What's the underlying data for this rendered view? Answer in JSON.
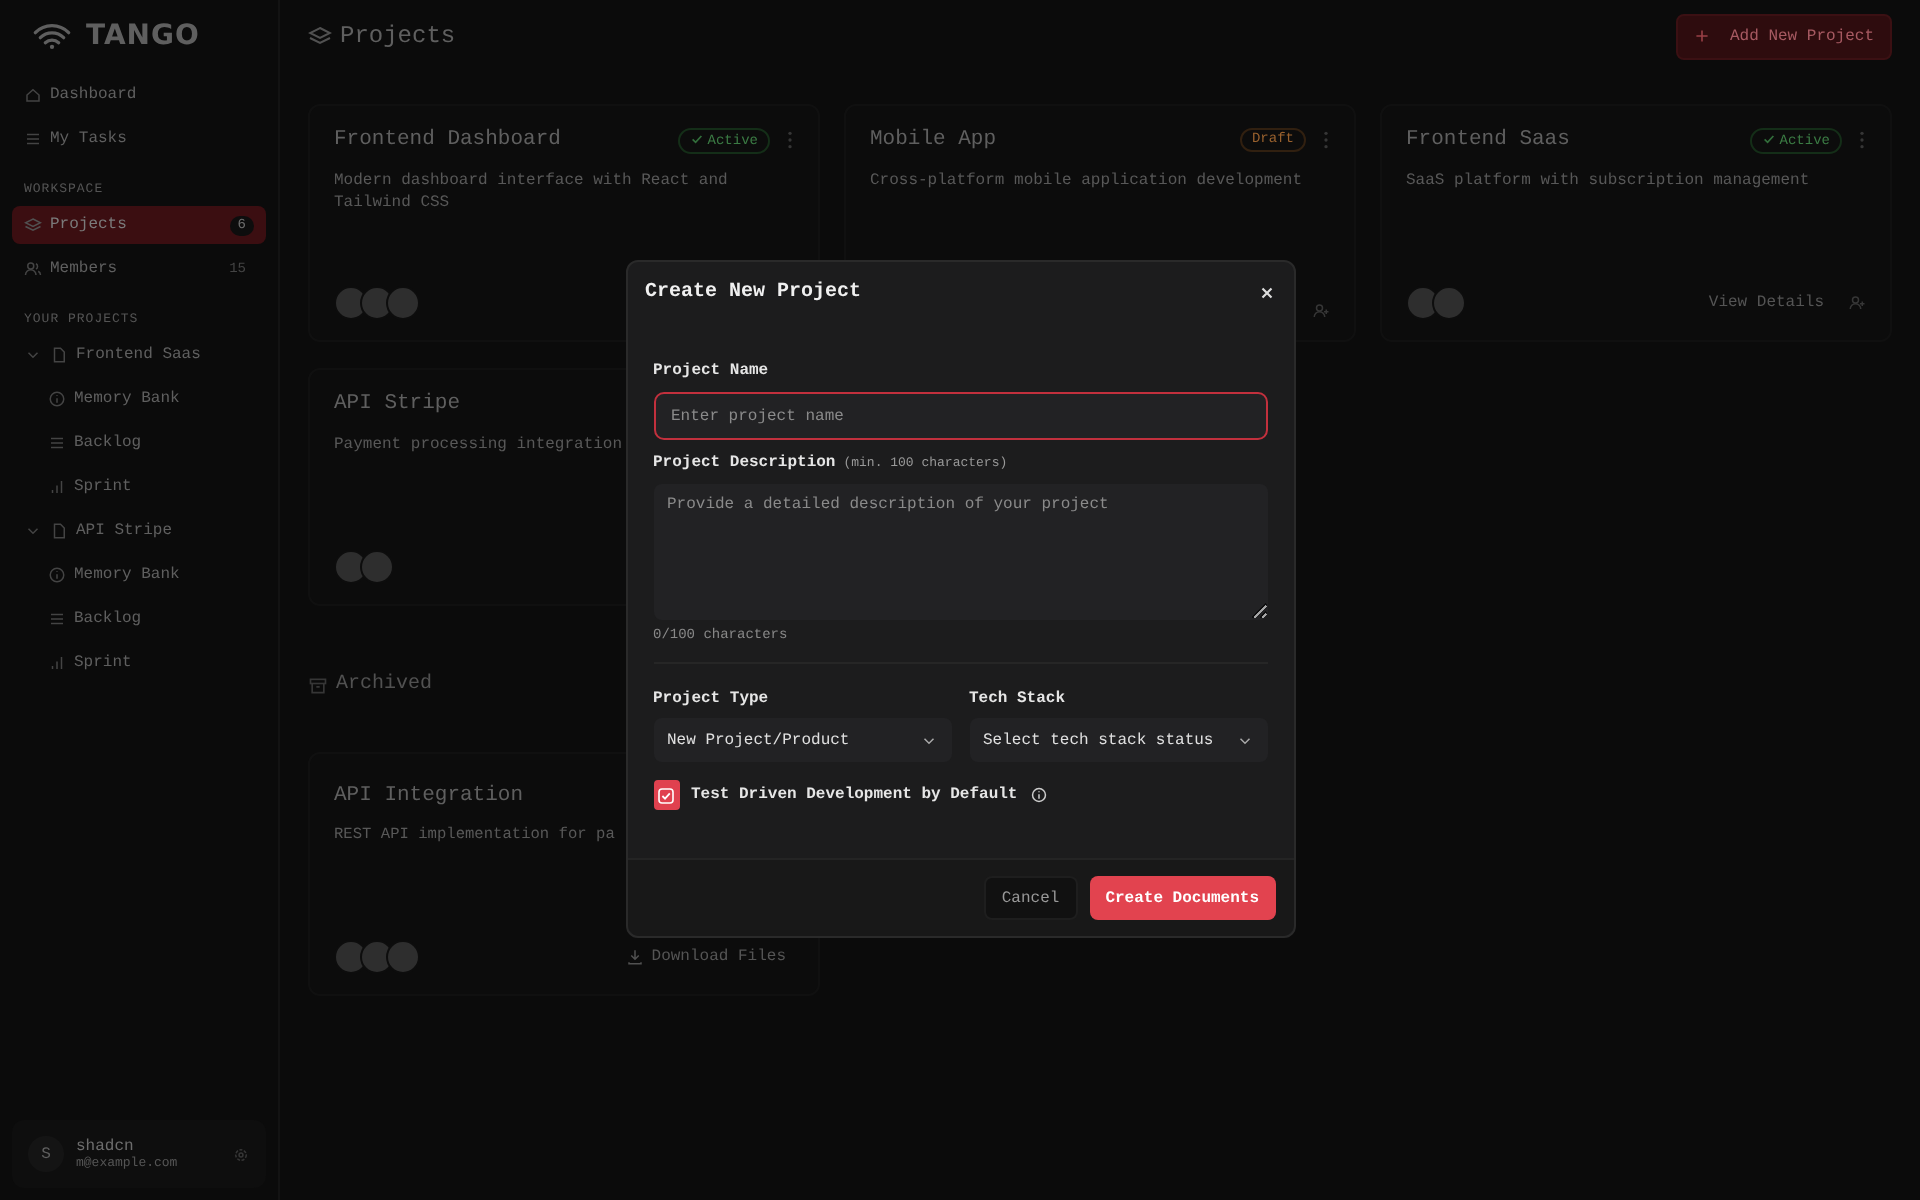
{
  "sidebar": {
    "brand": "TANGO",
    "nav": [
      {
        "label": "Dashboard",
        "selected": false
      },
      {
        "label": "My Tasks",
        "selected": false
      }
    ],
    "workspace_label": "WORKSPACE",
    "workspace": [
      {
        "label": "Projects",
        "count": "6",
        "selected": true
      },
      {
        "label": "Members",
        "count": "15",
        "selected": false
      }
    ],
    "projects_label": "YOUR PROJECTS",
    "projects": [
      {
        "label": "Frontend Saas",
        "expanded": true,
        "children": [
          {
            "label": "Memory Bank"
          },
          {
            "label": "Backlog"
          },
          {
            "label": "Sprint"
          }
        ]
      },
      {
        "label": "API Stripe",
        "expanded": true,
        "children": [
          {
            "label": "Memory Bank"
          },
          {
            "label": "Backlog"
          },
          {
            "label": "Sprint"
          }
        ]
      }
    ],
    "user": {
      "initial": "S",
      "name": "shadcn",
      "email": "m@example.com"
    }
  },
  "header": {
    "title": "Projects",
    "button": "Add New Project"
  },
  "projects": [
    {
      "title": "Frontend Dashboard",
      "status": {
        "label": "Active",
        "kind": "active"
      },
      "description": "Modern dashboard interface with React and Tailwind CSS"
    },
    {
      "title": "Mobile App",
      "status": {
        "label": "Draft",
        "kind": "draft"
      },
      "description": "Cross-platform mobile application development"
    },
    {
      "title": "Frontend Saas",
      "status": {
        "label": "Active",
        "kind": "active"
      },
      "description": "SaaS platform with subscription management",
      "action": "View Details"
    },
    {
      "title": "API Stripe",
      "description": "Payment processing integration"
    }
  ],
  "archived": {
    "title": "Archived",
    "projects": [
      {
        "title": "API Integration",
        "description": "REST API implementation for pa",
        "action": "Download Files"
      }
    ]
  },
  "dialog": {
    "title": "Create New Project",
    "name_label": "Project Name",
    "name_placeholder": "Enter project name",
    "desc_label": "Project Description",
    "desc_hint": "(min. 100 characters)",
    "desc_placeholder": "Provide a detailed description of your project",
    "desc_counter": "0/100 characters",
    "type_label": "Project Type",
    "type_value": "New Project/Product",
    "stack_label": "Tech Stack",
    "stack_value": "Select tech stack status",
    "tdd": {
      "label": "Test Driven Development by Default",
      "checked": true
    },
    "cancel": "Cancel",
    "submit": "Create Documents"
  }
}
